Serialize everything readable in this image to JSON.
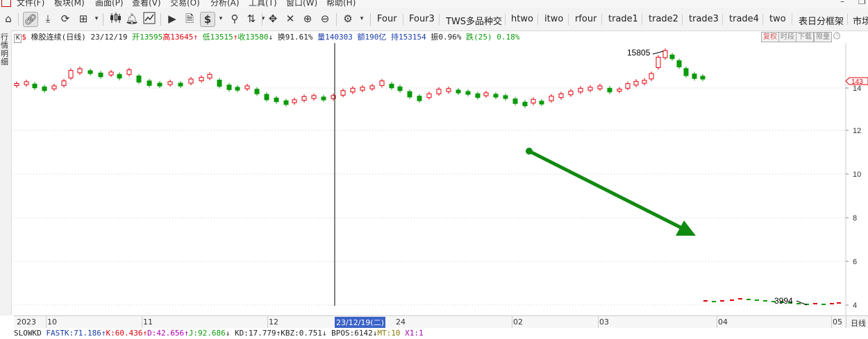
{
  "menu": {
    "items": [
      "文件(F)",
      "板块(M)",
      "画面(P)",
      "查看(V)",
      "交易(O)",
      "分析(A)",
      "工具(T)",
      "窗口(W)",
      "帮助(H)"
    ],
    "window_min": "–",
    "window_restore": "❐"
  },
  "toolbar": {
    "icons": [
      "home-icon",
      "link-icon",
      "download-icon",
      "refresh-icon",
      "grid-icon",
      "chevron-down-icon",
      "candlestick-icon",
      "bell-icon",
      "line-chart-icon",
      "play-icon",
      "document-icon",
      "dollar-icon",
      "chevron-down-icon",
      "filter-icon",
      "sort-icon",
      "chevron-down-icon",
      "move-icon",
      "cross-tool-icon",
      "zoom-in-icon",
      "zoom-out-icon",
      "gear-icon",
      "chevron-down-icon"
    ],
    "tabs": [
      "Four",
      "Four3",
      "TWS多品种交",
      "htwo",
      "itwo",
      "rfour",
      "trade1",
      "trade2",
      "trade3",
      "trade4",
      "two",
      "表日分框架",
      "市场"
    ]
  },
  "vstrip": {
    "text": "行情明细"
  },
  "infobar": {
    "k_label": "K",
    "dollar": "$",
    "title": "橡胶连续(日线)",
    "date": "23/12/19",
    "open_label": "开",
    "open": "13595",
    "high_label": "高",
    "high": "13645",
    "low_label": "低",
    "low": "13515",
    "close_label": "收",
    "close": "13580",
    "turnover_label": "换",
    "turnover": "91.61%",
    "volume_label": "量",
    "volume": "140303",
    "amount_label": "额",
    "amount": "190亿",
    "hold_label": "持",
    "hold": "153154",
    "amplitude_label": "振",
    "amplitude": "0.96%",
    "change_label": "跌",
    "change": "(25)",
    "change_pct": "0.18%",
    "buttons": [
      "复权",
      "时段",
      "下载",
      "限量"
    ]
  },
  "chart_data": {
    "type": "candlestick",
    "annotations": {
      "high_label": "15805",
      "low_label": "3994"
    },
    "y_ticks": [
      "14",
      "12",
      "10",
      "8",
      "6",
      "4"
    ],
    "current_price_tag": "143",
    "colors": {
      "up": "#e0000a",
      "down": "#0a9a0a",
      "arrow": "#118a11"
    }
  },
  "xaxis": {
    "labels": [
      "2023",
      "10",
      "11",
      "12",
      "24",
      "02",
      "03",
      "04",
      "05"
    ],
    "selected": "23/12/19(二)",
    "right_label": "日线"
  },
  "indicators": {
    "name": "SLOWKD",
    "fastk_label": "FASTK:",
    "fastk": "71.186",
    "k_label": "K:",
    "k": "60.436",
    "d_label": "D:",
    "d": "42.656",
    "j_label": "J:",
    "j": "92.686",
    "kd_label": "KD:",
    "kd": "17.779",
    "kbz_label": "KBZ:",
    "kbz": "0.751",
    "bpos_label": "BPOS:",
    "bpos": "6142",
    "mt_label": "MT:",
    "mt": "10",
    "x1_label": "X1:",
    "x1": "1"
  }
}
